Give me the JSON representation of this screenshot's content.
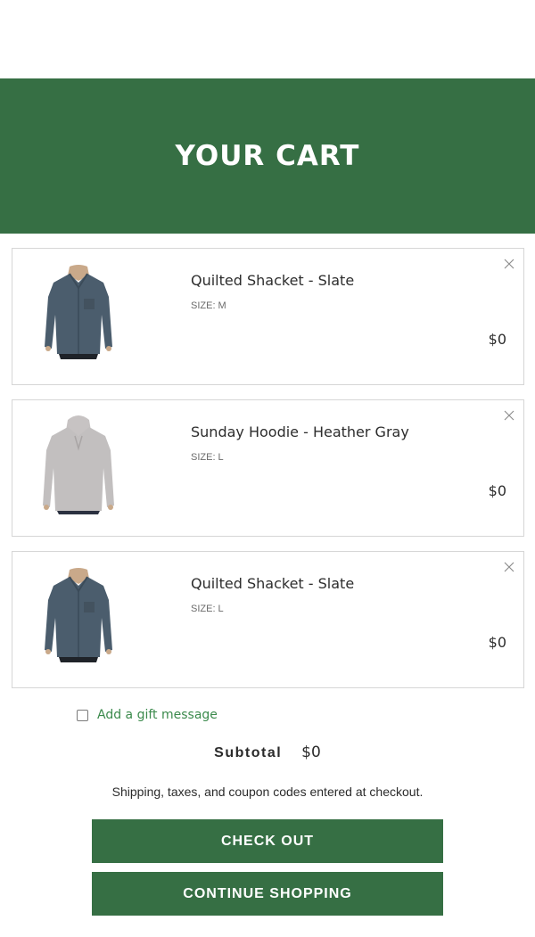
{
  "header": {
    "title": "YOUR CART"
  },
  "cart": {
    "items": [
      {
        "name": "Quilted Shacket - Slate",
        "size": "SIZE: M",
        "price": "$0",
        "image": "slate-shacket"
      },
      {
        "name": "Sunday Hoodie - Heather Gray",
        "size": "SIZE: L",
        "price": "$0",
        "image": "gray-hoodie"
      },
      {
        "name": "Quilted Shacket - Slate",
        "size": "SIZE: L",
        "price": "$0",
        "image": "slate-shacket"
      }
    ],
    "remove_icon": "close-icon"
  },
  "gift": {
    "label": "Add a gift message",
    "checked": false
  },
  "summary": {
    "subtotal_label": "Subtotal",
    "subtotal_value": "$0",
    "shipping_note": "Shipping, taxes, and coupon codes entered at checkout."
  },
  "actions": {
    "checkout_label": "CHECK OUT",
    "continue_label": "CONTINUE SHOPPING"
  },
  "colors": {
    "brand_green": "#366f44",
    "link_green": "#3b8a4c",
    "border": "#d6d6d6"
  }
}
